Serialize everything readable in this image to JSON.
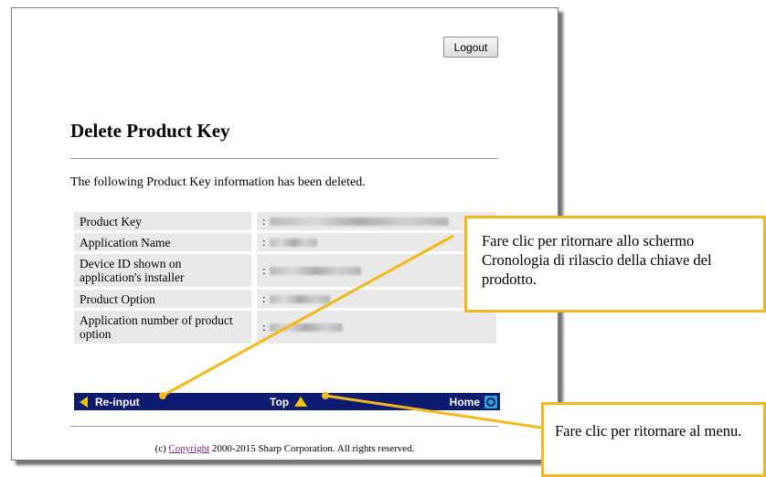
{
  "header": {
    "logout_label": "Logout"
  },
  "page": {
    "title": "Delete Product Key",
    "notice": "The following Product Key information has been deleted."
  },
  "info_table": [
    {
      "label": "Product Key",
      "value": ":"
    },
    {
      "label": "Application Name",
      "value": ":"
    },
    {
      "label": "Device ID shown on application's installer",
      "value": ":"
    },
    {
      "label": "Product Option",
      "value": ":"
    },
    {
      "label": "Application number of product option",
      "value": ":"
    }
  ],
  "nav": {
    "reinput_label": "Re-input",
    "top_label": "Top",
    "home_label": "Home",
    "bar_color": "#0d1b70",
    "arrow_color": "#f4c400"
  },
  "footer": {
    "prefix": "(c) ",
    "copyright_link": "Copyright",
    "suffix": " 2000-2015 Sharp Corporation. All rights reserved."
  },
  "callouts": {
    "reinput_text": "Fare clic per ritornare allo schermo Cronologia di rilascio della chiave del prodotto.",
    "menu_text": "Fare clic per ritornare al menu.",
    "border_color": "#f4b81c"
  }
}
